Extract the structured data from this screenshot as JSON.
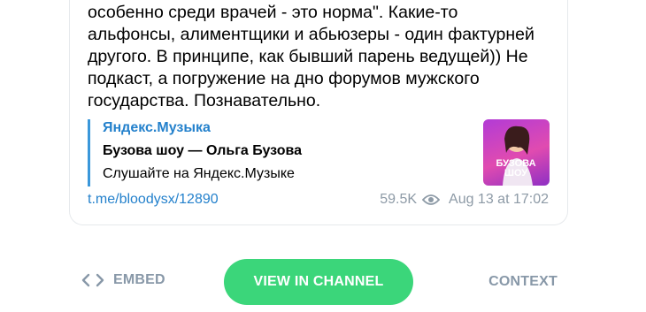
{
  "message": {
    "text": "особенно среди врачей - это норма\". Какие-то\nальфонсы, алиментщики и абьюзеры - один фактурней\nдругого. В принципе, как бывший парень ведущей)) Не\nподкаст, а погружение на дно форумов мужского\nгосударства. Познавательно."
  },
  "preview": {
    "site": "Яндекс.Музыка",
    "title": "Бузова шоу — Ольга Бузова",
    "description": "Слушайте на Яндекс.Музыке",
    "thumbnail_text": [
      "БУЗОВА",
      "ШОУ"
    ],
    "thumbnail_icon": "podcast-cover-image"
  },
  "meta": {
    "link": "t.me/bloodysx/12890",
    "views": "59.5K",
    "views_icon": "eye-icon",
    "date": "Aug 13 at 17:02"
  },
  "actions": {
    "embed_label": "EMBED",
    "embed_icon": "code-icon",
    "view_label": "VIEW IN CHANNEL",
    "context_label": "CONTEXT"
  },
  "colors": {
    "accent_link": "#2481cc",
    "button_green": "#3bd67a",
    "muted": "#8d9aa6",
    "preview_bar": "#3a97da"
  }
}
